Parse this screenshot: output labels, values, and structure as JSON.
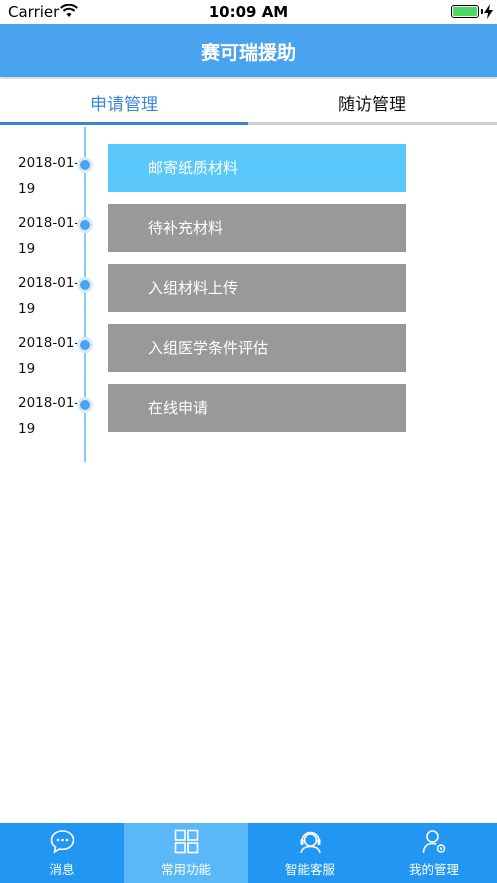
{
  "status_bar": {
    "carrier": "Carrier",
    "time": "10:09 AM"
  },
  "nav": {
    "title": "赛可瑞援助"
  },
  "tabs": [
    {
      "label": "申请管理",
      "active": true
    },
    {
      "label": "随访管理",
      "active": false
    }
  ],
  "timeline": [
    {
      "date": "2018-01-19",
      "label": "邮寄纸质材料",
      "active": true
    },
    {
      "date": "2018-01-19",
      "label": "待补充材料",
      "active": false
    },
    {
      "date": "2018-01-19",
      "label": "入组材料上传",
      "active": false
    },
    {
      "date": "2018-01-19",
      "label": "入组医学条件评估",
      "active": false
    },
    {
      "date": "2018-01-19",
      "label": "在线申请",
      "active": false
    }
  ],
  "tab_bar": [
    {
      "label": "消息",
      "icon": "message-icon",
      "active": false
    },
    {
      "label": "常用功能",
      "icon": "grid-icon",
      "active": true
    },
    {
      "label": "智能客服",
      "icon": "headset-icon",
      "active": false
    },
    {
      "label": "我的管理",
      "icon": "user-settings-icon",
      "active": false
    }
  ],
  "colors": {
    "accent": "#3b86d8",
    "nav_bg": "#4aa3ef",
    "tab_bar_bg": "#2196f3",
    "card_active": "#5ac8fa",
    "card_inactive": "#999999"
  }
}
